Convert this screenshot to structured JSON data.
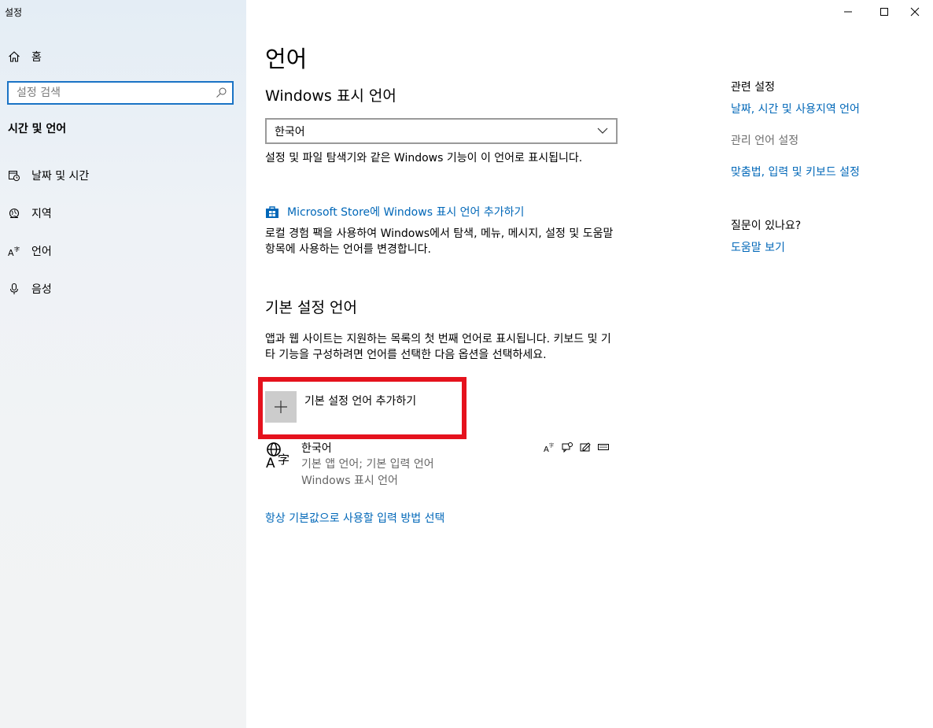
{
  "window": {
    "title": "설정",
    "minimize_icon": "minimize-icon",
    "maximize_icon": "maximize-icon",
    "close_icon": "close-icon"
  },
  "sidebar": {
    "home_label": "홈",
    "search_placeholder": "설정 검색",
    "section_title": "시간 및 언어",
    "items": [
      {
        "label": "날짜 및 시간",
        "icon": "calendar-clock-icon"
      },
      {
        "label": "지역",
        "icon": "globe-icon"
      },
      {
        "label": "언어",
        "icon": "language-icon"
      },
      {
        "label": "음성",
        "icon": "microphone-icon"
      }
    ]
  },
  "main": {
    "page_title": "언어",
    "display_language": {
      "heading": "Windows 표시 언어",
      "selected": "한국어",
      "description": "설정 및 파일 탐색기와 같은 Windows 기능이 이 언어로 표시됩니다.",
      "store_link": "Microsoft Store에 Windows 표시 언어 추가하기",
      "store_description": "로컬 경험 팩을 사용하여 Windows에서 탐색, 메뉴, 메시지, 설정 및 도움말 항목에 사용하는 언어를 변경합니다."
    },
    "preferred_languages": {
      "heading": "기본 설정 언어",
      "description": "앱과 웹 사이트는 지원하는 목록의 첫 번째 언어로 표시됩니다. 키보드 및 기타 기능을 구성하려면 언어를 선택한 다음 옵션을 선택하세요.",
      "add_label": "기본 설정 언어 추가하기",
      "languages": [
        {
          "name": "한국어",
          "line1": "기본 앱 언어; 기본 입력 언어",
          "line2": "Windows 표시 언어",
          "features": [
            "display-language-icon",
            "speech-icon",
            "handwriting-icon",
            "keyboard-icon"
          ]
        }
      ],
      "input_method_link": "항상 기본값으로 사용할 입력 방법 선택"
    }
  },
  "related": {
    "heading": "관련 설정",
    "link1": "날짜, 시간 및 사용지역 언어",
    "disabled": "관리 언어 설정",
    "link2": "맞춤법, 입력 및 키보드 설정",
    "question_heading": "질문이 있나요?",
    "help_link": "도움말 보기"
  },
  "colors": {
    "accent": "#0067b8",
    "highlight_box": "#e5121d"
  }
}
